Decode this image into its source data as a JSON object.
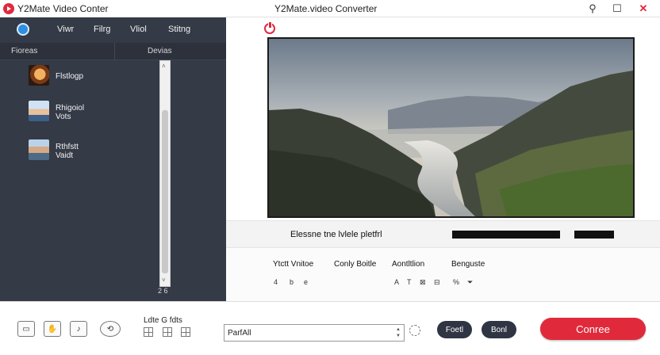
{
  "window": {
    "title_left": "Y2Mate Video Conter",
    "title_center": "Y2Mate.video Converter",
    "controls": {
      "search": "⚲",
      "maximize": "☐",
      "close": "✕"
    }
  },
  "menu": {
    "items": [
      "Viwr",
      "Filrg",
      "Vliol",
      "Stitng"
    ]
  },
  "sidebar": {
    "columns": [
      "Fioreas",
      "Devias"
    ],
    "files": [
      {
        "label_line1": "Flstlogp",
        "label_line2": ""
      },
      {
        "label_line1": "Rhigoiol",
        "label_line2": "Vots"
      },
      {
        "label_line1": "Rthfstt",
        "label_line2": "Vaidt"
      }
    ],
    "scroll_count": "2 6",
    "scroll_up": "˄",
    "scroll_down": "˅"
  },
  "output_path": {
    "label": "Elessne tne lvlele pletfrl"
  },
  "options": {
    "headers": [
      "Ytctt Vnitoe",
      "Conly Boitle",
      "Aontltlion",
      "Benguste"
    ],
    "icons": [
      "4",
      "b",
      "e",
      "A",
      "T",
      "⊠",
      "⊟",
      "%",
      "⏷"
    ]
  },
  "bottom": {
    "tool_icons": [
      "▭",
      "✋",
      "♪",
      "⟲"
    ],
    "destination_label": "Ldte G fdts",
    "destination_value": "ParfAll",
    "pill_1": "Foetl",
    "pill_2": "Bonl",
    "convert_label": "Conree"
  },
  "colors": {
    "accent": "#e02a3c",
    "sidebar_bg": "#343a46",
    "pill_bg": "#2f3542"
  }
}
